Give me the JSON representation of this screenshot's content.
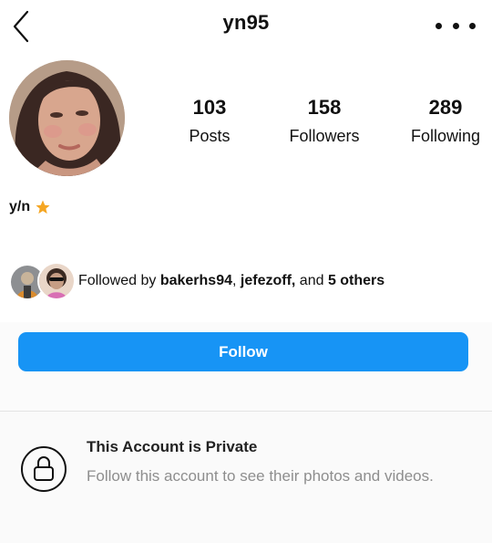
{
  "header": {
    "username": "yn95",
    "back_icon": "chevron-left-icon",
    "more_icon": "more-horizontal-icon"
  },
  "profile": {
    "display_name": "y/n",
    "name_badge_icon": "star-icon",
    "star_color": "#f5a623"
  },
  "stats": [
    {
      "value": "103",
      "label": "Posts"
    },
    {
      "value": "158",
      "label": "Followers"
    },
    {
      "value": "289",
      "label": "Following"
    }
  ],
  "followed_by": {
    "prefix": "Followed by ",
    "user1": "bakerhs94",
    "sep1": ", ",
    "user2": "jefezoff,",
    "and_text": " and ",
    "others": "5 others"
  },
  "follow_button": {
    "label": "Follow",
    "color": "#1794f5"
  },
  "private": {
    "title": "This Account is Private",
    "description": "Follow this account to see their photos and videos.",
    "icon": "lock-icon"
  }
}
